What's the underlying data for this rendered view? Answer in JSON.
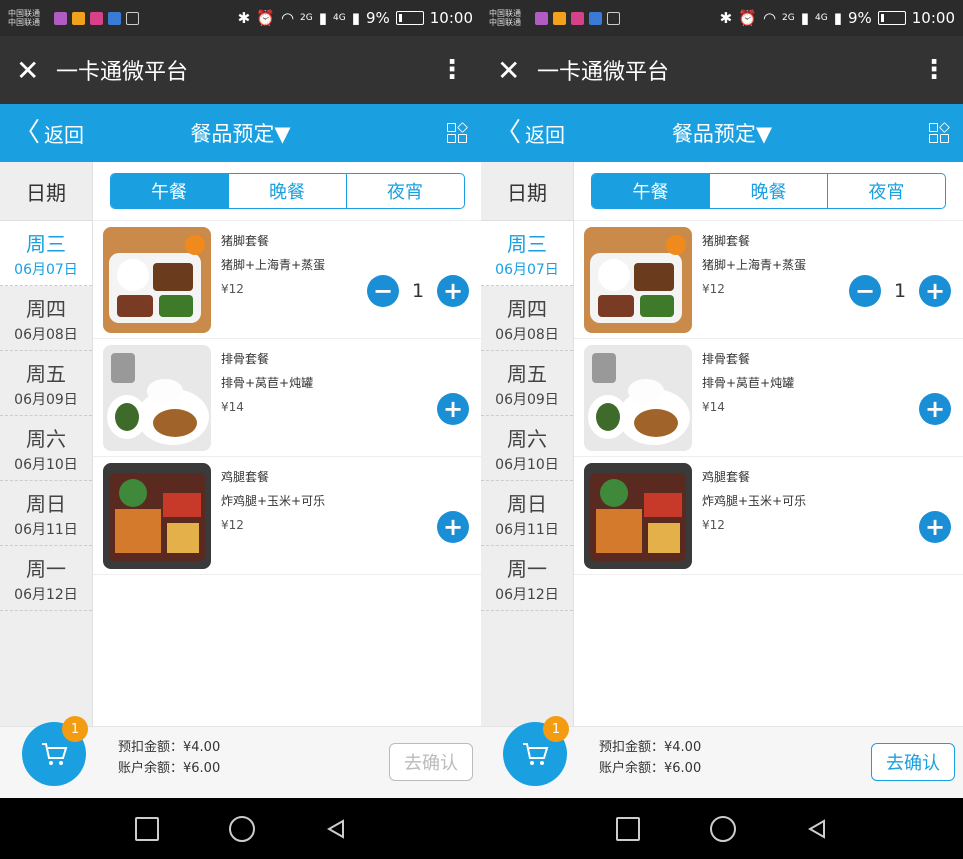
{
  "status": {
    "carrier_1": "中国联通",
    "carrier_2": "中国联通",
    "net_2g": "2G",
    "net_4g": "4G",
    "battery": "9%",
    "time": "10:00"
  },
  "wechat": {
    "title": "一卡通微平台"
  },
  "app": {
    "back_label": "返回",
    "title": "餐品预定▼"
  },
  "dates": {
    "header": "日期",
    "items": [
      {
        "weekday": "周三",
        "date": "06月07日"
      },
      {
        "weekday": "周四",
        "date": "06月08日"
      },
      {
        "weekday": "周五",
        "date": "06月09日"
      },
      {
        "weekday": "周六",
        "date": "06月10日"
      },
      {
        "weekday": "周日",
        "date": "06月11日"
      },
      {
        "weekday": "周一",
        "date": "06月12日"
      }
    ],
    "selected_index": 0
  },
  "tabs": [
    "午餐",
    "晚餐",
    "夜宵"
  ],
  "meals": [
    {
      "name": "猪脚套餐",
      "desc": "猪脚+上海青+蒸蛋",
      "price": "¥12",
      "qty": "1"
    },
    {
      "name": "排骨套餐",
      "desc": "排骨+莴苣+炖罐",
      "price": "¥14"
    },
    {
      "name": "鸡腿套餐",
      "desc": "炸鸡腿+玉米+可乐",
      "price": "¥12"
    }
  ],
  "cart": {
    "badge": "1"
  },
  "summary": {
    "prepay": "预扣金额：¥4.00",
    "balance": "账户余额：¥6.00"
  },
  "confirm_label": "去确认",
  "colors": {
    "accent": "#1aa0e0",
    "badge": "#f39c12"
  }
}
